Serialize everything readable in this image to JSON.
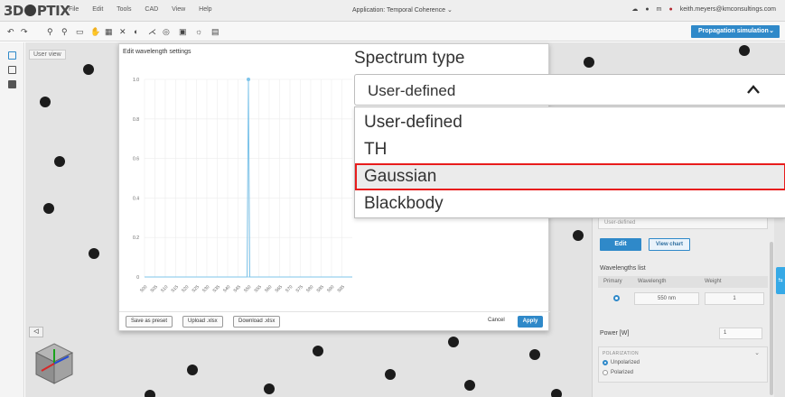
{
  "app": {
    "logo": "3DOptiX",
    "menu": [
      "File",
      "Edit",
      "Tools",
      "CAD",
      "View",
      "Help"
    ],
    "title": "Application: Temporal Coherence",
    "user_initial": "m",
    "user_email": "keith.meyers@kmconsultings.com",
    "propagation_button": "Propagation simulation"
  },
  "viewport": {
    "user_view_label": "User view"
  },
  "modal": {
    "title": "Edit wavelength settings",
    "buttons": {
      "save_preset": "Save as preset",
      "upload": "Upload .xlsx",
      "download": "Download .xlsx",
      "cancel": "Cancel",
      "apply": "Apply"
    }
  },
  "spectrum": {
    "title": "Spectrum type",
    "selected": "User-defined",
    "options": [
      "User-defined",
      "TH",
      "Gaussian",
      "Blackbody"
    ],
    "highlighted_option": "Gaussian"
  },
  "panel": {
    "spectrum_value": "User-defined",
    "edit_label": "Edit",
    "view_chart_label": "View chart",
    "wavelength_list_title": "Wavelengths list",
    "columns": [
      "Primary",
      "Wavelength",
      "Weight"
    ],
    "rows": [
      {
        "wavelength": "550 nm",
        "weight": "1"
      }
    ],
    "power_label": "Power [W]",
    "power_value": "1",
    "polarization_title": "POLARIZATION",
    "polarization_options": [
      "Unpolarized",
      "Polarized"
    ],
    "polarization_selected": "Unpolarized"
  },
  "colors": {
    "accent": "#2f89c9",
    "highlight_border": "#e81c1c",
    "chart_line": "#7ec4ea"
  },
  "chart_data": {
    "type": "line",
    "x": [
      550
    ],
    "y": [
      1.0
    ],
    "x_ticks": [
      "500",
      "505",
      "510",
      "515",
      "520",
      "525",
      "530",
      "535",
      "540",
      "545",
      "550",
      "555",
      "560",
      "565",
      "570",
      "575",
      "580",
      "585",
      "590",
      "595"
    ],
    "y_ticks": [
      "0",
      "0.2",
      "0.4",
      "0.6",
      "0.8",
      "1.0"
    ],
    "xlim": [
      500,
      600
    ],
    "ylim": [
      0,
      1.0
    ],
    "grid": true
  }
}
